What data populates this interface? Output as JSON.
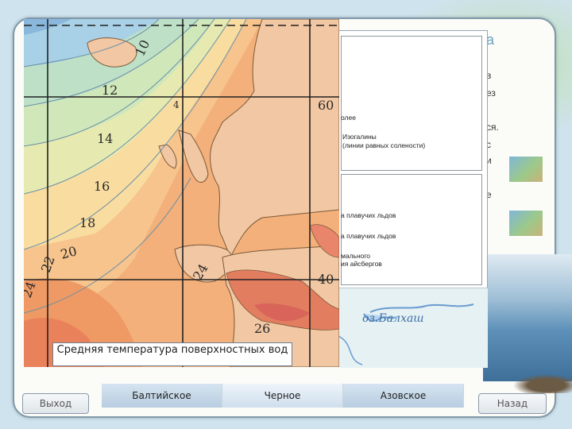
{
  "title_fragment": "а",
  "right_text_lines": [
    "в",
    "ез",
    "",
    "ся.",
    "с",
    "и",
    "",
    "е"
  ],
  "legend": {
    "line1": "олее",
    "isohaline_title": "Изогалины",
    "isohaline_sub": "(линии равных солености)",
    "ice1": "а плавучих льдов",
    "ice2": "а плавучих льдов",
    "ice3a": "мального",
    "ice3b": "ия айсбергов"
  },
  "lower_map_label": "оз.Балхаш",
  "map": {
    "isotherm_labels": [
      "10",
      "12",
      "14",
      "16",
      "18",
      "20",
      "22",
      "24",
      "24",
      "26",
      "4"
    ],
    "latitude_labels": [
      "60",
      "40"
    ]
  },
  "caption": "Средняя температура поверхностных вод",
  "nav": {
    "exit": "Выход",
    "back": "Назад",
    "tabs": [
      "Балтийское",
      "Черное",
      "Азовское"
    ]
  },
  "colors": {
    "panel_border": "#7f98aa",
    "sea_cool": "#9fc6e6",
    "sea_warm": "#f0a060",
    "land": "#f2c7a3"
  }
}
